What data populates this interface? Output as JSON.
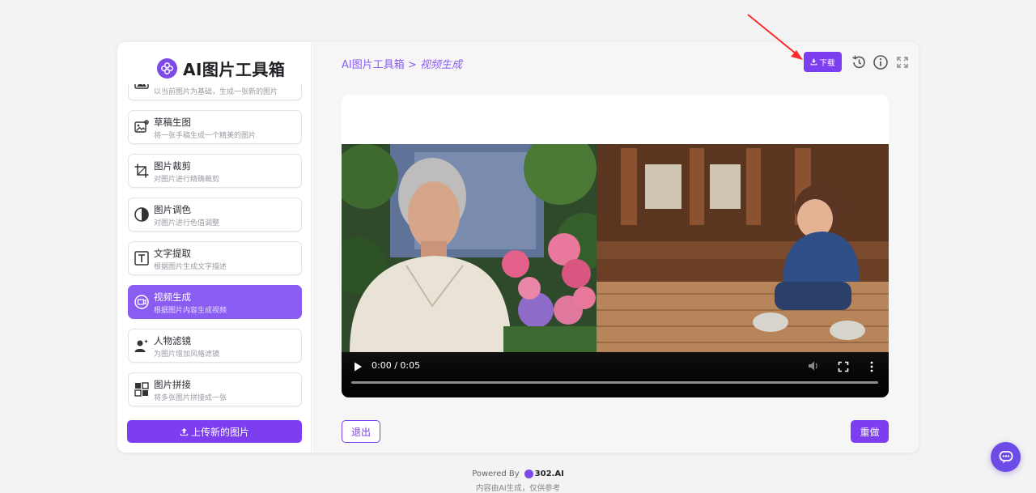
{
  "app": {
    "title": "AI图片工具箱"
  },
  "sidebar": {
    "items": [
      {
        "icon": "image-icon",
        "name": "",
        "desc": "以当前图片为基础，生成一张新的图片",
        "active": false
      },
      {
        "icon": "sketch-image-icon",
        "name": "草稿生图",
        "desc": "将一张手稿生成一个精美的图片",
        "active": false
      },
      {
        "icon": "crop-icon",
        "name": "图片裁剪",
        "desc": "对图片进行精确裁剪",
        "active": false
      },
      {
        "icon": "contrast-icon",
        "name": "图片调色",
        "desc": "对图片进行色值调整",
        "active": false
      },
      {
        "icon": "text-extract-icon",
        "name": "文字提取",
        "desc": "根据图片生成文字描述",
        "active": false
      },
      {
        "icon": "video-generate-icon",
        "name": "视频生成",
        "desc": "根据图片内容生成视频",
        "active": true
      },
      {
        "icon": "person-filter-icon",
        "name": "人物滤镜",
        "desc": "为图片增加风格滤镜",
        "active": false
      },
      {
        "icon": "collage-icon",
        "name": "图片拼接",
        "desc": "将多张图片拼接成一张",
        "active": false
      }
    ],
    "upload_label": "上传新的图片"
  },
  "header": {
    "breadcrumb_root": "AI图片工具箱",
    "breadcrumb_sep": ">",
    "breadcrumb_current": "视频生成",
    "download_label": "下载"
  },
  "video": {
    "time": "0:00 / 0:05"
  },
  "actions": {
    "exit_label": "退出",
    "redo_label": "重做"
  },
  "footer": {
    "powered_by": "Powered By",
    "brand": "302.AI",
    "disclaimer": "内容由AI生成，仅供参考"
  },
  "colors": {
    "accent": "#7d3ef0",
    "accent_light": "#8a5cf2",
    "page_bg": "#f3f3f4",
    "annotation_arrow": "#ff2a2a"
  }
}
